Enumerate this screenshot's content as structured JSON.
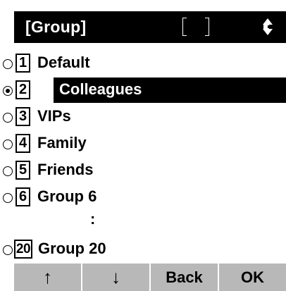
{
  "header": {
    "title": "[Group]",
    "field_value": "",
    "scroll_icon": "up-down-arrow-icon"
  },
  "list": {
    "selected_index": 1,
    "items": [
      {
        "number": "1",
        "label": "Default",
        "selected": false
      },
      {
        "number": "2",
        "label": "Colleagues",
        "selected": true
      },
      {
        "number": "3",
        "label": "VIPs",
        "selected": false
      },
      {
        "number": "4",
        "label": "Family",
        "selected": false
      },
      {
        "number": "5",
        "label": "Friends",
        "selected": false
      },
      {
        "number": "6",
        "label": "Group 6",
        "selected": false
      }
    ],
    "ellipsis": ":",
    "last_item": {
      "number": "20",
      "label": "Group 20",
      "selected": false
    }
  },
  "softkeys": {
    "up": "↑",
    "down": "↓",
    "back": "Back",
    "ok": "OK"
  },
  "colors": {
    "header_bg": "#000000",
    "header_text": "#ffffff",
    "highlight_bg": "#000000",
    "highlight_text": "#ffffff",
    "softkey_bg": "#b8b8b8",
    "text": "#000000"
  }
}
